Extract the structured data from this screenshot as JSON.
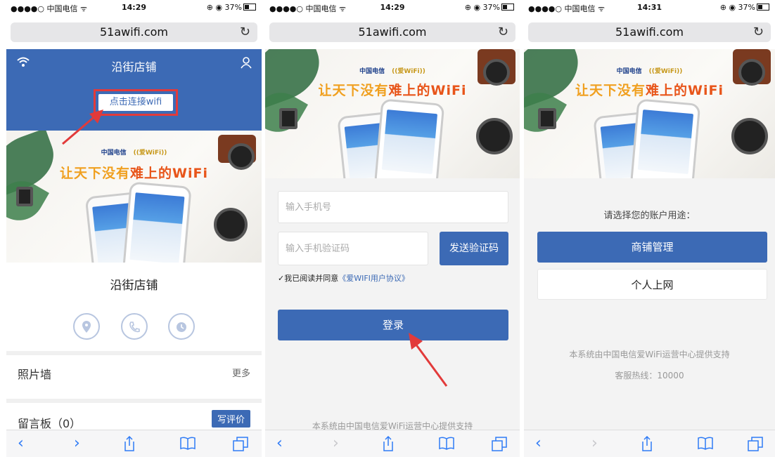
{
  "status_bar": [
    {
      "carrier": "●●●●○ 中国电信 ᯤ",
      "time": "14:29",
      "right": "⊕ ◉ 37%"
    },
    {
      "carrier": "●●●●○ 中国电信 ᯤ",
      "time": "14:29",
      "right": "⊕ ◉ 37%"
    },
    {
      "carrier": "●●●●○ 中国电信 ᯤ",
      "time": "14:31",
      "right": "⊕ ◉ 37%"
    }
  ],
  "url": "51awifi.com",
  "reload_icon": "↻",
  "banner": {
    "logo_telecom": "中国电信",
    "logo_wifi": "((爱WiFi))",
    "slogan_prefix": "让天下没有",
    "slogan_highlight": "难上的WiFi"
  },
  "panel1": {
    "header_title": "沿街店铺",
    "connect_button": "点击连接wifi",
    "store_name": "沿街店铺",
    "photo_wall": "照片墙",
    "more": "更多",
    "message_board": "留言板（0）",
    "write_review": "写评价"
  },
  "panel2": {
    "phone_placeholder": "输入手机号",
    "code_placeholder": "输入手机验证码",
    "send_code": "发送验证码",
    "agree_prefix": "✓我已阅读并同意",
    "agree_link": "《爱WIFI用户协议》",
    "login": "登录",
    "footer": "本系统由中国电信爱WiFi运营中心提供支持"
  },
  "panel3": {
    "prompt": "请选择您的账户用途：",
    "shop_manage": "商铺管理",
    "personal": "个人上网",
    "footer": "本系统由中国电信爱WiFi运营中心提供支持",
    "hotline": "客服热线：10000"
  },
  "colors": {
    "brand_blue": "#3c6ab5",
    "highlight_red": "#e23a3a",
    "ios_blue": "#2f7bf6"
  }
}
